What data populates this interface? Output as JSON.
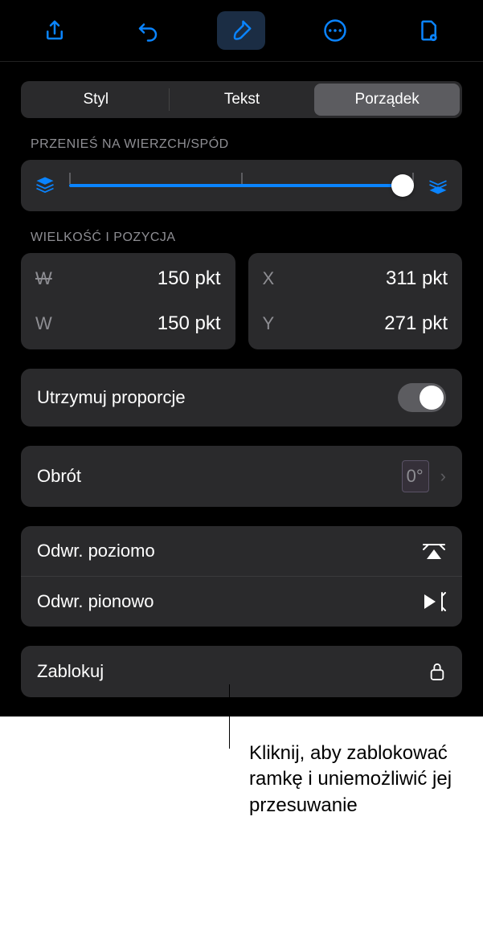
{
  "tabs": {
    "style": "Styl",
    "text": "Tekst",
    "arrange": "Porządek"
  },
  "sections": {
    "layer": "PRZENIEŚ NA WIERZCH/SPÓD",
    "size_pos": "WIELKOŚĆ I POZYCJA"
  },
  "size": {
    "w_label": "W",
    "w_value": "150 pkt",
    "h_label": "W",
    "h_value": "150 pkt",
    "x_label": "X",
    "x_value": "311 pkt",
    "y_label": "Y",
    "y_value": "271 pkt"
  },
  "rows": {
    "constrain": "Utrzymuj proporcje",
    "rotation": "Obrót",
    "rotation_value": "0°",
    "flip_h": "Odwr. poziomo",
    "flip_v": "Odwr. pionowo",
    "lock": "Zablokuj"
  },
  "callout": "Kliknij, aby zablokować ramkę i uniemożliwić jej przesuwanie"
}
